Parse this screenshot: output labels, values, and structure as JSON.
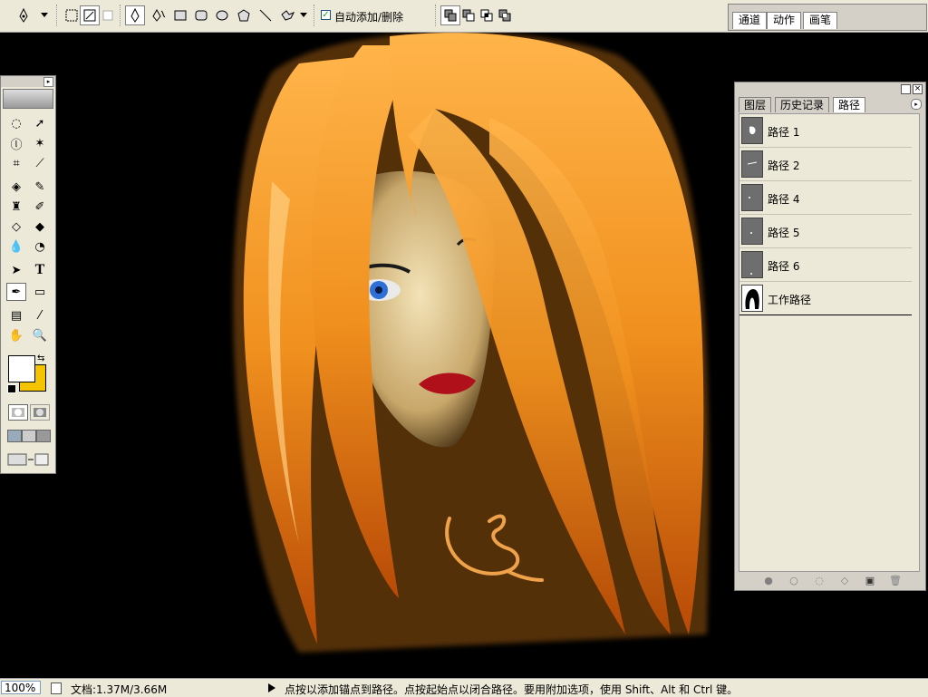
{
  "options_bar": {
    "auto_add_delete_label": "自动添加/删除",
    "auto_add_delete_checked": true,
    "icons": [
      "pen-tool-icon",
      "dropdown-arrow-icon",
      "shape-layers-icon",
      "paths-icon",
      "fill-pixels-icon",
      "pen-icon",
      "freeform-pen-icon",
      "rectangle-icon",
      "rounded-rectangle-icon",
      "ellipse-icon",
      "polygon-icon",
      "line-icon",
      "custom-shape-icon",
      "add-to-path-icon",
      "subtract-path-icon",
      "intersect-path-icon",
      "exclude-path-icon"
    ]
  },
  "palette_well": {
    "tabs": [
      "通道",
      "动作",
      "画笔"
    ]
  },
  "toolbox": {
    "foreground_color": "#ffffff",
    "background_color": "#f5c400"
  },
  "paths_panel": {
    "tabs": [
      "图层",
      "历史记录",
      "路径"
    ],
    "active_tab": "路径",
    "items": [
      {
        "name": "路径 1"
      },
      {
        "name": "路径 2"
      },
      {
        "name": "路径 4"
      },
      {
        "name": "路径 5"
      },
      {
        "name": "路径 6"
      },
      {
        "name": "工作路径"
      }
    ]
  },
  "status_bar": {
    "zoom": "100%",
    "doc_info": "文档:1.37M/3.66M",
    "hint": "点按以添加锚点到路径。点按起始点以闭合路径。要用附加选项，使用 Shift、Alt 和 Ctrl 键。"
  },
  "colors": {
    "hair": "#f08a1a",
    "hair_light": "#ffc26a",
    "canvas_bg": "#000000",
    "eye": "#2f6fd8",
    "lips": "#b0101a"
  }
}
